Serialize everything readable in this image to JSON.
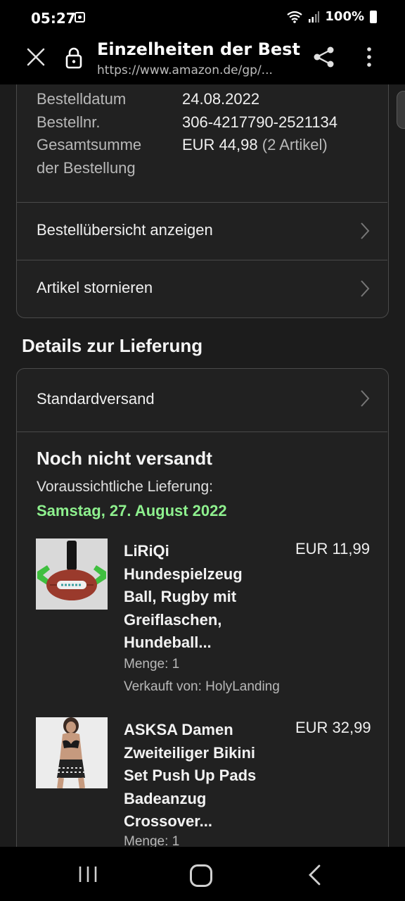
{
  "status_bar": {
    "time": "05:27",
    "battery": "100%"
  },
  "browser": {
    "title": "Einzelheiten der Best...",
    "url": "https://www.amazon.de/gp/..."
  },
  "order": {
    "date_label": "Bestelldatum",
    "date_value": "24.08.2022",
    "number_label": "Bestellnr.",
    "number_value": "306-4217790-2521134",
    "total_label_1": "Gesamtsumme",
    "total_label_2": "der Bestellung",
    "total_value": "EUR 44,98",
    "total_count": "(2 Artikel)",
    "overview_link": "Bestellübersicht anzeigen",
    "cancel_link": "Artikel stornieren"
  },
  "delivery": {
    "section_title": "Details zur Lieferung",
    "shipping_method": "Standardversand",
    "status": "Noch nicht versandt",
    "expected_label": "Voraussichtliche Lieferung:",
    "expected_date": "Samstag, 27. August 2022"
  },
  "items": [
    {
      "title": "LiRiQi Hundespielzeug Ball, Rugby mit Greiflaschen, Hundeball...",
      "price": "EUR 11,99",
      "quantity": "Menge: 1",
      "seller": "Verkauft von: HolyLanding"
    },
    {
      "title": "ASKSA Damen Zweiteiliger Bikini Set Push Up Pads Badeanzug Crossover...",
      "price": "EUR 32,99",
      "quantity": "Menge: 1"
    }
  ],
  "colors": {
    "accent_green": "#8ef08e",
    "background": "#1c1c1c",
    "border": "#4a4a4a"
  }
}
